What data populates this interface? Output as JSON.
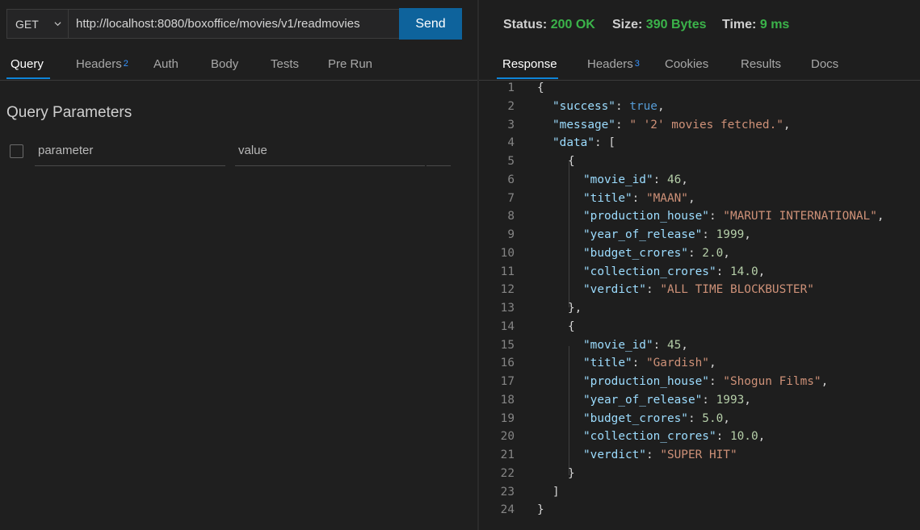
{
  "request": {
    "method": "GET",
    "url": "http://localhost:8080/boxoffice/movies/v1/readmovies",
    "send_label": "Send"
  },
  "request_tabs": [
    {
      "label": "Query",
      "active": true
    },
    {
      "label": "Headers",
      "badge": "2"
    },
    {
      "label": "Auth"
    },
    {
      "label": "Body"
    },
    {
      "label": "Tests"
    },
    {
      "label": "Pre Run"
    }
  ],
  "query": {
    "title": "Query Parameters",
    "param_placeholder": "parameter",
    "value_placeholder": "value"
  },
  "status": {
    "status_label": "Status:",
    "status_value": "200 OK",
    "size_label": "Size:",
    "size_value": "390 Bytes",
    "time_label": "Time:",
    "time_value": "9 ms"
  },
  "response_tabs": [
    {
      "label": "Response",
      "active": true
    },
    {
      "label": "Headers",
      "badge": "3"
    },
    {
      "label": "Cookies"
    },
    {
      "label": "Results"
    },
    {
      "label": "Docs"
    }
  ],
  "response_lines": [
    {
      "n": "1",
      "indent": 0,
      "parts": [
        [
          "p",
          "{"
        ]
      ]
    },
    {
      "n": "2",
      "indent": 1,
      "parts": [
        [
          "k",
          "\"success\""
        ],
        [
          "p",
          ": "
        ],
        [
          "b",
          "true"
        ],
        [
          "p",
          ","
        ]
      ]
    },
    {
      "n": "3",
      "indent": 1,
      "parts": [
        [
          "k",
          "\"message\""
        ],
        [
          "p",
          ": "
        ],
        [
          "s",
          "\" '2' movies fetched.\""
        ],
        [
          "p",
          ","
        ]
      ]
    },
    {
      "n": "4",
      "indent": 1,
      "parts": [
        [
          "k",
          "\"data\""
        ],
        [
          "p",
          ": ["
        ]
      ]
    },
    {
      "n": "5",
      "indent": 2,
      "parts": [
        [
          "p",
          "{"
        ]
      ]
    },
    {
      "n": "6",
      "indent": 3,
      "parts": [
        [
          "k",
          "\"movie_id\""
        ],
        [
          "p",
          ": "
        ],
        [
          "n",
          "46"
        ],
        [
          "p",
          ","
        ]
      ]
    },
    {
      "n": "7",
      "indent": 3,
      "parts": [
        [
          "k",
          "\"title\""
        ],
        [
          "p",
          ": "
        ],
        [
          "s",
          "\"MAAN\""
        ],
        [
          "p",
          ","
        ]
      ]
    },
    {
      "n": "8",
      "indent": 3,
      "parts": [
        [
          "k",
          "\"production_house\""
        ],
        [
          "p",
          ": "
        ],
        [
          "s",
          "\"MARUTI INTERNATIONAL\""
        ],
        [
          "p",
          ","
        ]
      ]
    },
    {
      "n": "9",
      "indent": 3,
      "parts": [
        [
          "k",
          "\"year_of_release\""
        ],
        [
          "p",
          ": "
        ],
        [
          "n",
          "1999"
        ],
        [
          "p",
          ","
        ]
      ]
    },
    {
      "n": "10",
      "indent": 3,
      "parts": [
        [
          "k",
          "\"budget_crores\""
        ],
        [
          "p",
          ": "
        ],
        [
          "n",
          "2.0"
        ],
        [
          "p",
          ","
        ]
      ]
    },
    {
      "n": "11",
      "indent": 3,
      "parts": [
        [
          "k",
          "\"collection_crores\""
        ],
        [
          "p",
          ": "
        ],
        [
          "n",
          "14.0"
        ],
        [
          "p",
          ","
        ]
      ]
    },
    {
      "n": "12",
      "indent": 3,
      "parts": [
        [
          "k",
          "\"verdict\""
        ],
        [
          "p",
          ": "
        ],
        [
          "s",
          "\"ALL TIME BLOCKBUSTER\""
        ]
      ]
    },
    {
      "n": "13",
      "indent": 2,
      "parts": [
        [
          "p",
          "},"
        ]
      ]
    },
    {
      "n": "14",
      "indent": 2,
      "parts": [
        [
          "p",
          "{"
        ]
      ]
    },
    {
      "n": "15",
      "indent": 3,
      "parts": [
        [
          "k",
          "\"movie_id\""
        ],
        [
          "p",
          ": "
        ],
        [
          "n",
          "45"
        ],
        [
          "p",
          ","
        ]
      ]
    },
    {
      "n": "16",
      "indent": 3,
      "parts": [
        [
          "k",
          "\"title\""
        ],
        [
          "p",
          ": "
        ],
        [
          "s",
          "\"Gardish\""
        ],
        [
          "p",
          ","
        ]
      ]
    },
    {
      "n": "17",
      "indent": 3,
      "parts": [
        [
          "k",
          "\"production_house\""
        ],
        [
          "p",
          ": "
        ],
        [
          "s",
          "\"Shogun Films\""
        ],
        [
          "p",
          ","
        ]
      ]
    },
    {
      "n": "18",
      "indent": 3,
      "parts": [
        [
          "k",
          "\"year_of_release\""
        ],
        [
          "p",
          ": "
        ],
        [
          "n",
          "1993"
        ],
        [
          "p",
          ","
        ]
      ]
    },
    {
      "n": "19",
      "indent": 3,
      "parts": [
        [
          "k",
          "\"budget_crores\""
        ],
        [
          "p",
          ": "
        ],
        [
          "n",
          "5.0"
        ],
        [
          "p",
          ","
        ]
      ]
    },
    {
      "n": "20",
      "indent": 3,
      "parts": [
        [
          "k",
          "\"collection_crores\""
        ],
        [
          "p",
          ": "
        ],
        [
          "n",
          "10.0"
        ],
        [
          "p",
          ","
        ]
      ]
    },
    {
      "n": "21",
      "indent": 3,
      "parts": [
        [
          "k",
          "\"verdict\""
        ],
        [
          "p",
          ": "
        ],
        [
          "s",
          "\"SUPER HIT\""
        ]
      ]
    },
    {
      "n": "22",
      "indent": 2,
      "parts": [
        [
          "p",
          "}"
        ]
      ]
    },
    {
      "n": "23",
      "indent": 1,
      "parts": [
        [
          "p",
          "]"
        ]
      ]
    },
    {
      "n": "24",
      "indent": 0,
      "parts": [
        [
          "p",
          "}"
        ]
      ]
    }
  ],
  "colors": {
    "accent": "#0e639c",
    "status_ok": "#3bb34a",
    "json_key": "#9cdcfe",
    "json_string": "#ce9178",
    "json_number": "#b5cea8",
    "json_bool": "#569cd6"
  }
}
